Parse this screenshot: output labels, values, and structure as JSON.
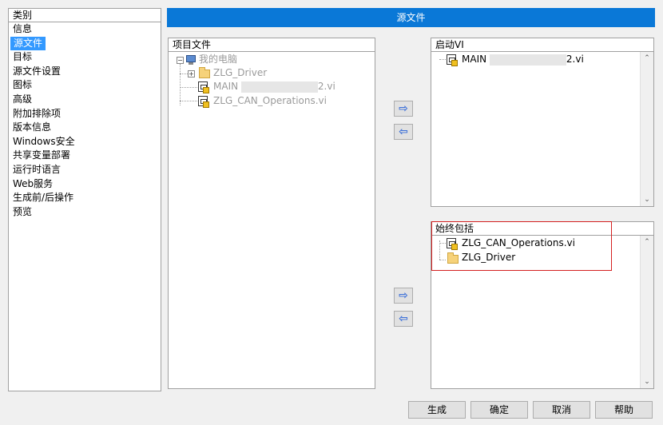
{
  "category": {
    "header": "类别",
    "items": [
      "信息",
      "源文件",
      "目标",
      "源文件设置",
      "图标",
      "高级",
      "附加排除项",
      "版本信息",
      "Windows安全",
      "共享变量部署",
      "运行时语言",
      "Web服务",
      "生成前/后操作",
      "预览"
    ],
    "selected_index": 1
  },
  "title": "源文件",
  "project": {
    "header": "项目文件",
    "root": "我的电脑",
    "items": [
      {
        "label": "ZLG_Driver",
        "type": "folder"
      },
      {
        "label_prefix": "MAIN",
        "label_suffix": "2.vi",
        "type": "vi"
      },
      {
        "label": "ZLG_CAN_Operations.vi",
        "type": "vi"
      }
    ]
  },
  "startup": {
    "header": "启动VI",
    "items": [
      {
        "label_prefix": "MAIN",
        "label_suffix": "2.vi"
      }
    ]
  },
  "always_include": {
    "header": "始终包括",
    "items": [
      {
        "label": "ZLG_CAN_Operations.vi",
        "type": "vi"
      },
      {
        "label": "ZLG_Driver",
        "type": "folder"
      }
    ]
  },
  "arrows": {
    "right": "⇨",
    "left": "⇦"
  },
  "buttons": {
    "build": "生成",
    "ok": "确定",
    "cancel": "取消",
    "help": "帮助"
  },
  "colors": {
    "title_bar": "#0a78d7",
    "selection": "#3399ff",
    "highlight_box": "#d42020"
  }
}
